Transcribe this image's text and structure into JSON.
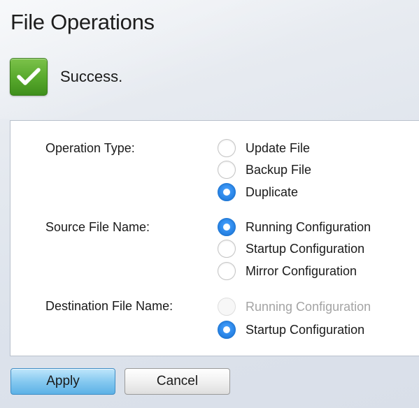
{
  "page": {
    "title": "File Operations"
  },
  "status": {
    "icon": "checkmark-icon",
    "message": "Success.",
    "color": "#57a82c"
  },
  "form": {
    "operation_type": {
      "label": "Operation Type:",
      "options": [
        {
          "label": "Update File",
          "checked": false,
          "disabled": false
        },
        {
          "label": "Backup File",
          "checked": false,
          "disabled": false
        },
        {
          "label": "Duplicate",
          "checked": true,
          "disabled": false
        }
      ]
    },
    "source_file_name": {
      "label": "Source File Name:",
      "options": [
        {
          "label": "Running Configuration",
          "checked": true,
          "disabled": false
        },
        {
          "label": "Startup Configuration",
          "checked": false,
          "disabled": false
        },
        {
          "label": "Mirror Configuration",
          "checked": false,
          "disabled": false
        }
      ]
    },
    "destination_file_name": {
      "label": "Destination File Name:",
      "options": [
        {
          "label": "Running Configuration",
          "checked": false,
          "disabled": true
        },
        {
          "label": "Startup Configuration",
          "checked": true,
          "disabled": false
        }
      ]
    }
  },
  "buttons": {
    "apply": "Apply",
    "cancel": "Cancel"
  },
  "colors": {
    "accent": "#2a86e8",
    "success": "#57a82c"
  }
}
